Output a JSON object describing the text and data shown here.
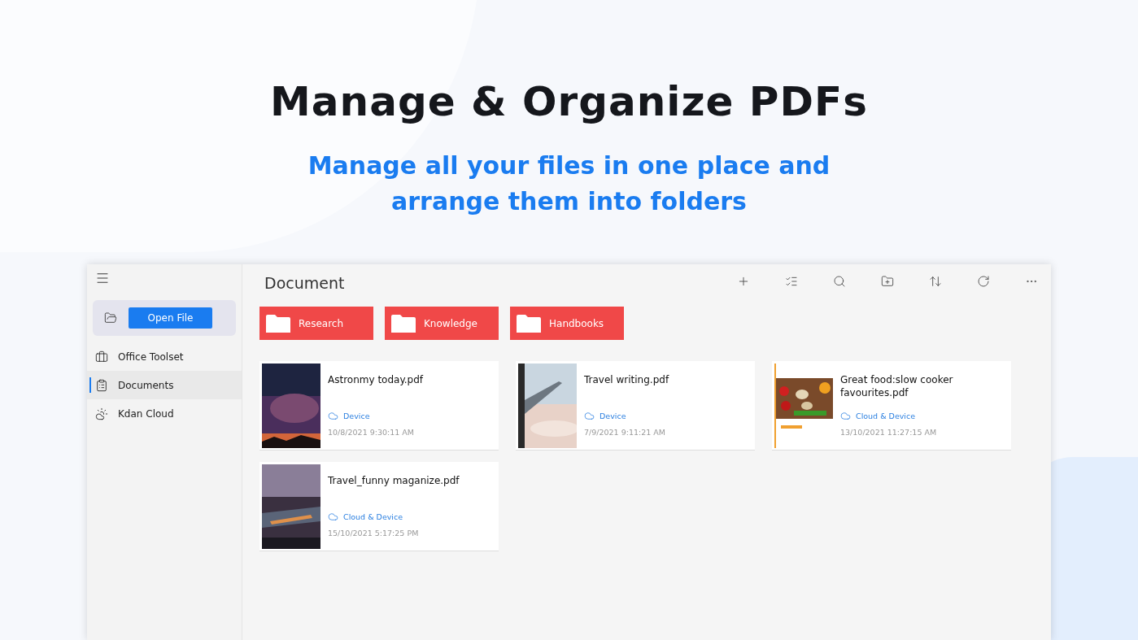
{
  "headline": "Manage & Organize PDFs",
  "subheadline": "Manage all your files in one place and arrange them into folders",
  "window": {
    "title": "Document",
    "sidebar": {
      "open_button": "Open File",
      "items": [
        {
          "label": "Office Toolset",
          "selected": false
        },
        {
          "label": "Documents",
          "selected": true
        },
        {
          "label": "Kdan Cloud",
          "selected": false
        }
      ]
    },
    "folders": [
      {
        "name": "Research"
      },
      {
        "name": "Knowledge"
      },
      {
        "name": "Handbooks"
      }
    ],
    "files": [
      {
        "name": "Astronmy today.pdf",
        "location": "Device",
        "date": "10/8/2021 9:30:11 AM"
      },
      {
        "name": "Travel writing.pdf",
        "location": "Device",
        "date": "7/9/2021 9:11:21 AM"
      },
      {
        "name": "Great food:slow cooker favourites.pdf",
        "location": "Cloud & Device",
        "date": "13/10/2021 11:27:15 AM"
      },
      {
        "name": "Travel_funny maganize.pdf",
        "location": "Cloud & Device",
        "date": "15/10/2021 5:17:25 PM"
      }
    ]
  }
}
